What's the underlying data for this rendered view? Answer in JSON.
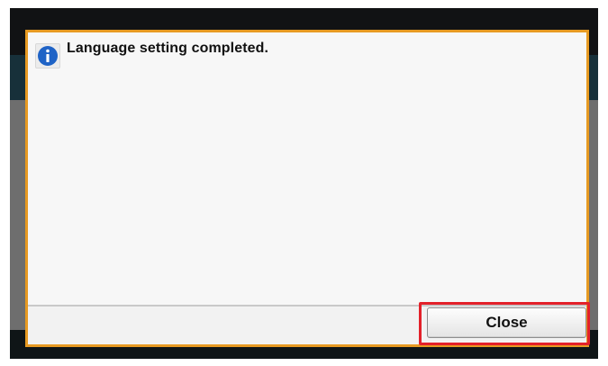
{
  "dialog": {
    "icon": "info-icon",
    "message": "Language setting completed.",
    "close_label": "Close"
  },
  "colors": {
    "dialog_border": "#e79a22",
    "highlight_border": "#e3212a",
    "info_icon": "#1f63c6",
    "screen_background": "#111214"
  }
}
